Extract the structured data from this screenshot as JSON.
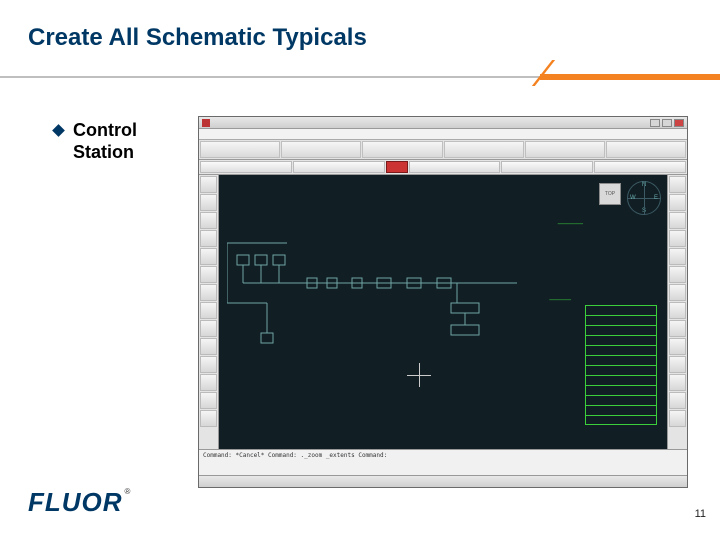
{
  "title": "Create All Schematic Typicals",
  "bullet": {
    "label": "Control Station"
  },
  "viewcube": "TOP",
  "compass": {
    "n": "N",
    "e": "E",
    "s": "S",
    "w": "W"
  },
  "cmdline": "Command: *Cancel*\nCommand: ._zoom _extents\nCommand:",
  "logo": "FLUOR",
  "registered": "®",
  "pagenum": "11"
}
